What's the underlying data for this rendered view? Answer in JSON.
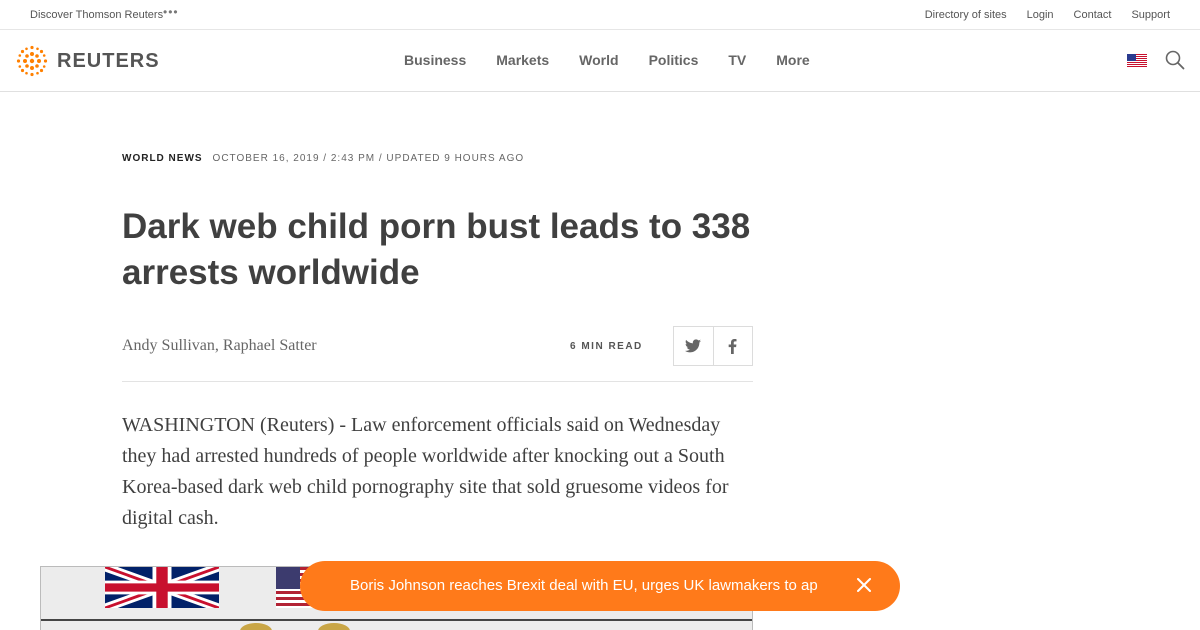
{
  "utility": {
    "discover": "Discover Thomson Reuters",
    "more_icon": "ellipsis-icon",
    "links": [
      "Directory of sites",
      "Login",
      "Contact",
      "Support"
    ]
  },
  "header": {
    "logo_text": "REUTERS",
    "logo_color": "#ff8000",
    "nav": [
      "Business",
      "Markets",
      "World",
      "Politics",
      "TV",
      "More"
    ],
    "region_icon": "us-flag-icon",
    "search_icon": "search-icon"
  },
  "article": {
    "section": "WORLD NEWS",
    "date": "OCTOBER 16, 2019 / 2:43 PM / UPDATED 9 HOURS AGO",
    "headline": "Dark web child porn bust leads to 338 arrests worldwide",
    "byline": "Andy Sullivan, Raphael Satter",
    "read_time": "6 MIN READ",
    "share": [
      "twitter-icon",
      "facebook-icon"
    ],
    "lead": "WASHINGTON (Reuters) - Law enforcement officials said on Wednesday they had arrested hundreds of people worldwide after knocking out a South Korea-based dark web child pornography site that sold gruesome videos for digital cash."
  },
  "toast": {
    "text": "Boris Johnson reaches Brexit deal with EU, urges UK lawmakers to ap",
    "color": "#ff7a1a"
  }
}
